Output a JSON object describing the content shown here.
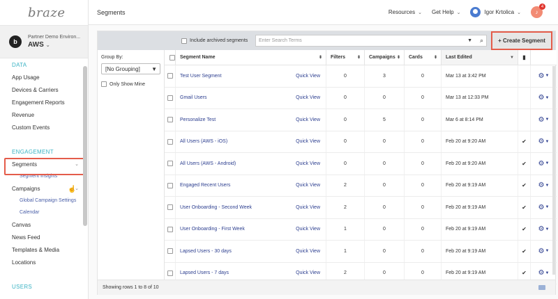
{
  "app": {
    "logo": "braze"
  },
  "workspace": {
    "initial": "b",
    "name": "Partner Demo Environ...",
    "env": "AWS"
  },
  "nav": {
    "data_section": "DATA",
    "data_items": [
      "App Usage",
      "Devices & Carriers",
      "Engagement Reports",
      "Revenue",
      "Custom Events"
    ],
    "engagement_section": "ENGAGEMENT",
    "segments": "Segments",
    "segment_insights": "Segment Insights",
    "campaigns": "Campaigns",
    "global_campaign_settings": "Global Campaign Settings",
    "calendar": "Calendar",
    "canvas": "Canvas",
    "news_feed": "News Feed",
    "templates_media": "Templates & Media",
    "locations": "Locations",
    "users_section": "USERS"
  },
  "topbar": {
    "title": "Segments",
    "resources": "Resources",
    "get_help": "Get Help",
    "user": "Igor Krtolica",
    "notif_count": "4"
  },
  "toolbar": {
    "archived_label": "Include archived segments",
    "search_placeholder": "Enter Search Terms",
    "create_label": "+ Create Segment"
  },
  "groupby": {
    "label": "Group By:",
    "value": "[No Grouping]",
    "only_mine": "Only Show Mine"
  },
  "table": {
    "headers": {
      "name": "Segment Name",
      "filters": "Filters",
      "campaigns": "Campaigns",
      "cards": "Cards",
      "last_edited": "Last Edited"
    },
    "quick_view": "Quick View",
    "rows": [
      {
        "name": "Test User Segment",
        "filters": "0",
        "campaigns": "3",
        "cards": "0",
        "edited": "Mar 13 at 3:42 PM",
        "star": ""
      },
      {
        "name": "Gmail Users",
        "filters": "0",
        "campaigns": "0",
        "cards": "0",
        "edited": "Mar 13 at 12:33 PM",
        "star": ""
      },
      {
        "name": "Personalize Test",
        "filters": "0",
        "campaigns": "5",
        "cards": "0",
        "edited": "Mar 6 at 8:14 PM",
        "star": ""
      },
      {
        "name": "All Users (AWS - iOS)",
        "filters": "0",
        "campaigns": "0",
        "cards": "0",
        "edited": "Feb 20 at 9:20 AM",
        "star": "✔"
      },
      {
        "name": "All Users (AWS - Android)",
        "filters": "0",
        "campaigns": "0",
        "cards": "0",
        "edited": "Feb 20 at 9:20 AM",
        "star": "✔"
      },
      {
        "name": "Engaged Recent Users",
        "filters": "2",
        "campaigns": "0",
        "cards": "0",
        "edited": "Feb 20 at 9:19 AM",
        "star": "✔"
      },
      {
        "name": "User Onboarding - Second Week",
        "filters": "2",
        "campaigns": "0",
        "cards": "0",
        "edited": "Feb 20 at 9:19 AM",
        "star": "✔"
      },
      {
        "name": "User Onboarding - First Week",
        "filters": "1",
        "campaigns": "0",
        "cards": "0",
        "edited": "Feb 20 at 9:19 AM",
        "star": "✔"
      },
      {
        "name": "Lapsed Users - 30 days",
        "filters": "1",
        "campaigns": "0",
        "cards": "0",
        "edited": "Feb 20 at 9:19 AM",
        "star": "✔"
      },
      {
        "name": "Lapsed Users - 7 days",
        "filters": "2",
        "campaigns": "0",
        "cards": "0",
        "edited": "Feb 20 at 9:19 AM",
        "star": "✔"
      }
    ],
    "footer": "Showing rows 1 to 8 of 10"
  }
}
